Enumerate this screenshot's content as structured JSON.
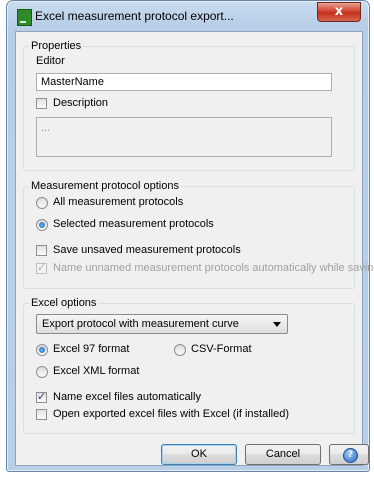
{
  "window": {
    "title": "Excel measurement protocol export...",
    "close_glyph": "x"
  },
  "properties": {
    "legend": "Properties",
    "editor_label": "Editor",
    "editor_value": "MasterName",
    "description_label": "Description",
    "description_checked": false,
    "description_placeholder": "..."
  },
  "protocol_options": {
    "legend": "Measurement protocol options",
    "radio_all": "All measurement protocols",
    "radio_selected": "Selected measurement protocols",
    "selected_option": "Selected measurement protocols",
    "save_unsaved_label": "Save unsaved measurement protocols",
    "save_unsaved_checked": false,
    "name_unnamed_label": "Name unnamed measurement protocols automatically while saving",
    "name_unnamed_checked": true,
    "name_unnamed_enabled": false
  },
  "excel_options": {
    "legend": "Excel options",
    "export_mode": "Export protocol with measurement curve",
    "format_97": "Excel 97 format",
    "format_csv": "CSV-Format",
    "format_xml": "Excel XML format",
    "selected_format": "Excel 97 format",
    "name_auto_label": "Name excel files automatically",
    "name_auto_checked": true,
    "open_after_label": "Open exported excel files with Excel (if installed)",
    "open_after_checked": false
  },
  "buttons": {
    "ok": "OK",
    "cancel": "Cancel",
    "help_glyph": "?"
  },
  "icons": {
    "app": "excel-app-icon",
    "close": "close-icon",
    "help": "help-icon"
  }
}
